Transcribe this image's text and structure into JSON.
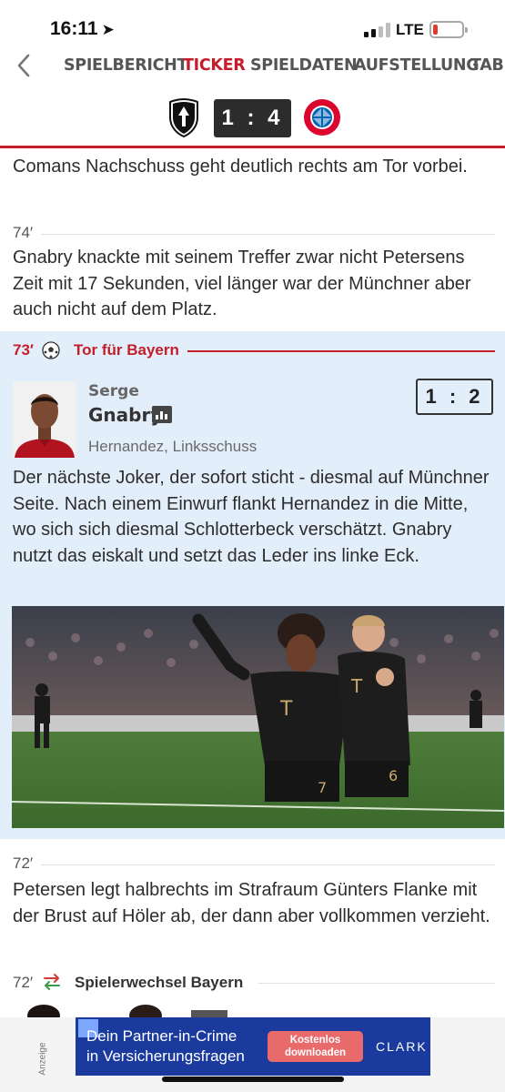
{
  "status_bar": {
    "time": "16:11",
    "network": "LTE",
    "battery_color": "#e23a2e"
  },
  "nav": {
    "back_icon": "chevron-left-icon",
    "tabs": [
      {
        "label": "SPIELBERICHT",
        "active": false
      },
      {
        "label": "TICKER",
        "active": true
      },
      {
        "label": "SPIELDATEN",
        "active": false
      },
      {
        "label": "AUFSTELLUNG",
        "active": false
      },
      {
        "label": "TABE",
        "active": false
      }
    ]
  },
  "match": {
    "home_crest": "sc-freiburg-crest",
    "away_crest": "fc-bayern-crest",
    "score": "1 : 4"
  },
  "feed": {
    "prev_text": "Comans Nachschuss geht deutlich rechts am Tor vorbei.",
    "entry_74": {
      "minute": "74′",
      "text": "Gnabry knackte mit seinem Treffer zwar nicht Petersens Zeit mit 17 Sekunden, viel länger war der Münchner aber auch nicht auf dem Platz."
    },
    "goal": {
      "minute": "73′",
      "icon": "soccer-ball-icon",
      "title": "Tor für Bayern",
      "player_first": "Serge",
      "player_last": "Gnabry",
      "assist": "Hernandez, Linksschuss",
      "score": "1 : 2",
      "text": "Der nächste Joker, der sofort sticht - diesmal auf Münchner Seite. Nach einem Einwurf flankt Hernandez in die Mitte, wo sich sich diesmal Schlotterbeck verschätzt. Gnabry nutzt das eiskalt und setzt das Leder ins linke Eck."
    },
    "entry_72": {
      "minute": "72′",
      "text": "Petersen legt halbrechts im Strafraum Günters Flanke mit der Brust auf Höler ab, der dann aber vollkommen verzieht."
    },
    "substitution": {
      "minute": "72′",
      "icon": "swap-arrows-icon",
      "title": "Spielerwechsel Bayern"
    }
  },
  "ad": {
    "label": "Anzeige",
    "text_line1": "Dein Partner-in-Crime",
    "text_line2": "in Versicherungsfragen",
    "cta_line1": "Kostenlos",
    "cta_line2": "downloaden",
    "brand": "CLARK"
  },
  "colors": {
    "accent_red": "#c41e2a",
    "goal_bg": "#e3eefb",
    "ad_bg": "#1a3a9e"
  }
}
